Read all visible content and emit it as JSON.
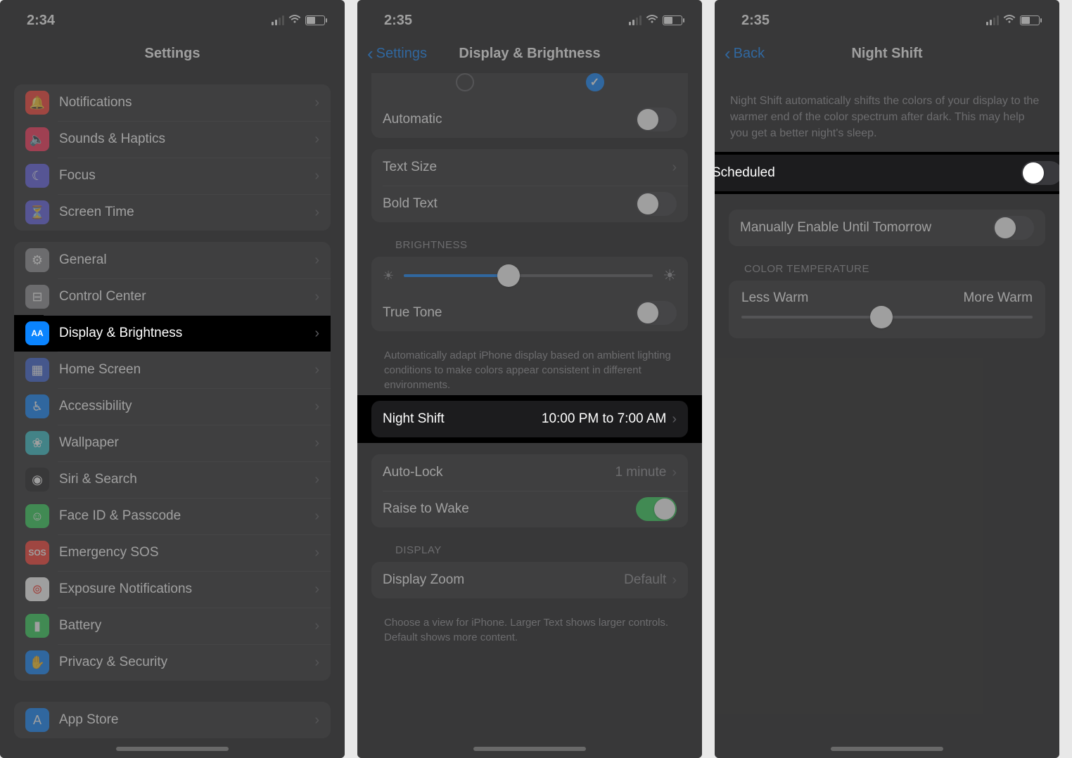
{
  "screen1": {
    "time": "2:34",
    "title": "Settings",
    "group_a": [
      {
        "icon": "bell-icon",
        "bg": "#ff3b30",
        "label": "Notifications"
      },
      {
        "icon": "speaker-icon",
        "bg": "#ff2d55",
        "label": "Sounds & Haptics"
      },
      {
        "icon": "moon-icon",
        "bg": "#5e5ce6",
        "label": "Focus"
      },
      {
        "icon": "hourglass-icon",
        "bg": "#5e5ce6",
        "label": "Screen Time"
      }
    ],
    "group_b": [
      {
        "icon": "gear-icon",
        "bg": "#8e8e93",
        "label": "General"
      },
      {
        "icon": "switches-icon",
        "bg": "#8e8e93",
        "label": "Control Center"
      },
      {
        "icon": "aa-icon",
        "bg": "#0a84ff",
        "label": "Display & Brightness",
        "highlight": true
      },
      {
        "icon": "grid-icon",
        "bg": "#3960d6",
        "label": "Home Screen"
      },
      {
        "icon": "accessibility-icon",
        "bg": "#0a84ff",
        "label": "Accessibility"
      },
      {
        "icon": "flower-icon",
        "bg": "#33c1c9",
        "label": "Wallpaper"
      },
      {
        "icon": "siri-icon",
        "bg": "#1c1c1e",
        "label": "Siri & Search"
      },
      {
        "icon": "face-icon",
        "bg": "#30d158",
        "label": "Face ID & Passcode"
      },
      {
        "icon": "sos-icon",
        "bg": "#ff3b30",
        "label": "Emergency SOS"
      },
      {
        "icon": "exposure-icon",
        "bg": "#ffffff",
        "label": "Exposure Notifications"
      },
      {
        "icon": "battery-icon",
        "bg": "#30d158",
        "label": "Battery"
      },
      {
        "icon": "hand-icon",
        "bg": "#0a84ff",
        "label": "Privacy & Security"
      }
    ],
    "group_c": [
      {
        "icon": "appstore-icon",
        "bg": "#0a84ff",
        "label": "App Store"
      }
    ]
  },
  "screen2": {
    "time": "2:35",
    "back": "Settings",
    "title": "Display & Brightness",
    "automatic": "Automatic",
    "text_size": "Text Size",
    "bold_text": "Bold Text",
    "brightness_header": "BRIGHTNESS",
    "true_tone": "True Tone",
    "true_tone_footer": "Automatically adapt iPhone display based on ambient lighting conditions to make colors appear consistent in different environments.",
    "night_shift": "Night Shift",
    "night_shift_value": "10:00 PM to 7:00 AM",
    "auto_lock": "Auto-Lock",
    "auto_lock_value": "1 minute",
    "raise_to_wake": "Raise to Wake",
    "display_header": "DISPLAY",
    "display_zoom": "Display Zoom",
    "display_zoom_value": "Default",
    "display_zoom_footer": "Choose a view for iPhone. Larger Text shows larger controls. Default shows more content."
  },
  "screen3": {
    "time": "2:35",
    "back": "Back",
    "title": "Night Shift",
    "description": "Night Shift automatically shifts the colors of your display to the warmer end of the color spectrum after dark. This may help you get a better night's sleep.",
    "scheduled": "Scheduled",
    "manual": "Manually Enable Until Tomorrow",
    "color_temp_header": "COLOR TEMPERATURE",
    "less_warm": "Less Warm",
    "more_warm": "More Warm"
  }
}
